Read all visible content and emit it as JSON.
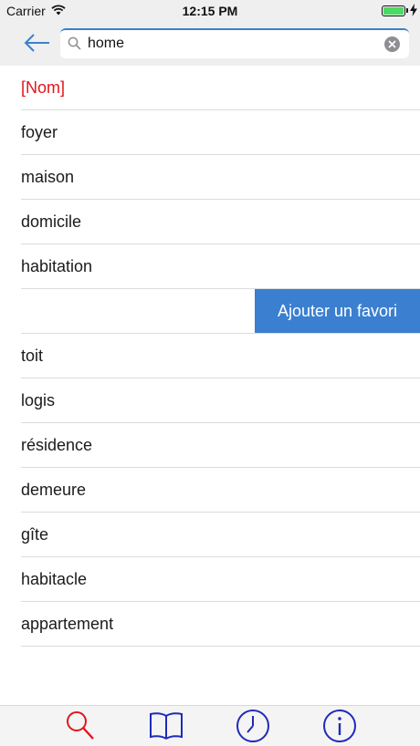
{
  "status_bar": {
    "carrier": "Carrier",
    "time": "12:15 PM",
    "battery_level": 1.0,
    "battery_color": "#4cd964"
  },
  "search": {
    "value": "home",
    "back_icon": "arrow-left-icon",
    "search_icon": "magnifier-icon",
    "clear_icon": "clear-circle-icon"
  },
  "results": {
    "category": "[Nom]",
    "items": [
      "foyer",
      "maison",
      "domicile",
      "habitation",
      "",
      "toit",
      "logis",
      "résidence",
      "demeure",
      "gîte",
      "habitacle",
      "appartement"
    ],
    "swipe_action": "Ajouter un favori"
  },
  "tab_bar": {
    "tabs": [
      {
        "icon": "search-icon",
        "color": "#e0161b",
        "selected": true
      },
      {
        "icon": "book-icon",
        "color": "#1f2bb8",
        "selected": false
      },
      {
        "icon": "clock-icon",
        "color": "#1f2bb8",
        "selected": false
      },
      {
        "icon": "info-icon",
        "color": "#1f2bb8",
        "selected": false
      }
    ]
  },
  "colors": {
    "accent": "#3b7fd0",
    "category": "#e0161b",
    "tab_active": "#e0161b",
    "tab_inactive": "#1f2bb8"
  }
}
